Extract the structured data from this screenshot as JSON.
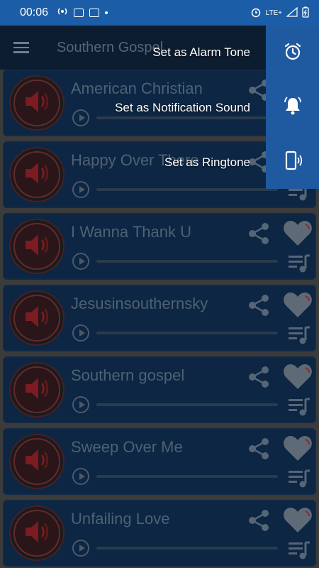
{
  "status_bar": {
    "time": "00:06",
    "network": "LTE+"
  },
  "app_bar": {
    "title": "Southern Gospel"
  },
  "menu": {
    "items": [
      {
        "label": "Set as Alarm Tone",
        "icon": "alarm-icon"
      },
      {
        "label": "Set as Notification Sound",
        "icon": "bell-icon"
      },
      {
        "label": "Set as Ringtone",
        "icon": "phone-ring-icon"
      }
    ]
  },
  "tracks": [
    {
      "title": "American Christian"
    },
    {
      "title": "Happy Over There"
    },
    {
      "title": "I Wanna Thank U"
    },
    {
      "title": "Jesusinsouthernsky"
    },
    {
      "title": "Southern gospel"
    },
    {
      "title": "Sweep Over Me"
    },
    {
      "title": "Unfailing Love"
    }
  ],
  "colors": {
    "status_bar": "#1b5da6",
    "app_bar": "#0d1d30",
    "card": "#0c2643",
    "action_panel": "#1f5aa0",
    "background": "#3b3b3b"
  }
}
